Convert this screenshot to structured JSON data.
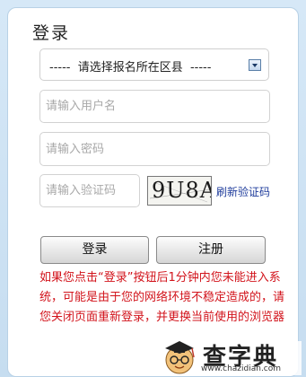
{
  "login": {
    "title": "登录",
    "region_select": "-----  请选择报名所在区县  -----",
    "username_placeholder": "请输入用户名",
    "password_placeholder": "请输入密码",
    "captcha_placeholder": "请输入验证码",
    "captcha_text": "9U8A",
    "refresh_captcha": "刷新验证码",
    "login_button": "登录",
    "register_button": "注册",
    "notice": "如果您点击“登录”按钮后1分钟内您未能进入系统，可能是由于您的网络环境不稳定造成的，请您关闭页面重新登录，并更换当前使用的浏览器"
  },
  "watermark": {
    "brand": "查字典",
    "url": "www.chazidian.com",
    "icon": "mascot-icon"
  }
}
